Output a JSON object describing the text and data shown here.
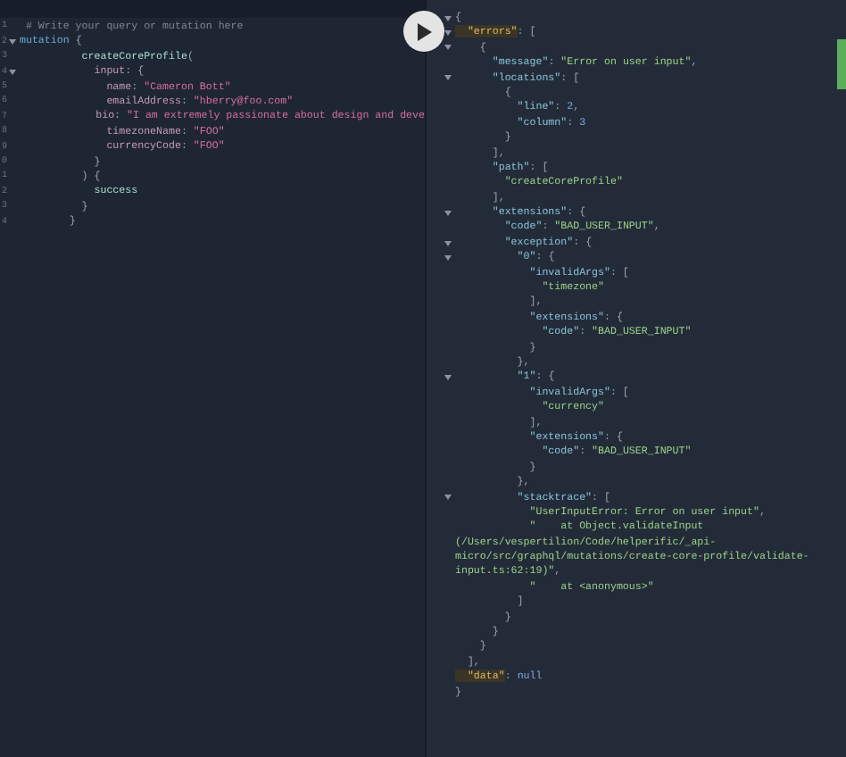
{
  "editor": {
    "lines": [
      {
        "number": "1",
        "fold": false,
        "tokens": [
          {
            "kind": "comment",
            "text": " # Write your query or mutation here"
          }
        ]
      },
      {
        "number": "2",
        "fold": true,
        "tokens": [
          {
            "kind": "keyword",
            "text": "mutation"
          },
          {
            "kind": "punct",
            "text": " {"
          }
        ]
      },
      {
        "number": "3",
        "fold": false,
        "tokens": [
          {
            "kind": "def",
            "text": "          createCoreProfile"
          },
          {
            "kind": "punct",
            "text": "("
          }
        ]
      },
      {
        "number": "4",
        "fold": true,
        "tokens": [
          {
            "kind": "attr",
            "text": "            input"
          },
          {
            "kind": "punct",
            "text": ": {"
          }
        ]
      },
      {
        "number": "5",
        "fold": false,
        "tokens": [
          {
            "kind": "attr",
            "text": "              name"
          },
          {
            "kind": "punct",
            "text": ": "
          },
          {
            "kind": "string",
            "text": "\"Cameron Bott\""
          }
        ]
      },
      {
        "number": "6",
        "fold": false,
        "tokens": [
          {
            "kind": "attr",
            "text": "              emailAddress"
          },
          {
            "kind": "punct",
            "text": ": "
          },
          {
            "kind": "string",
            "text": "\"hberry@foo.com\""
          }
        ]
      },
      {
        "number": "7",
        "fold": false,
        "tokens": [
          {
            "kind": "attr",
            "text": "              bio"
          },
          {
            "kind": "punct",
            "text": ": "
          },
          {
            "kind": "string",
            "text": "\"I am extremely passionate about design and deve"
          }
        ]
      },
      {
        "number": "8",
        "fold": false,
        "tokens": [
          {
            "kind": "attr",
            "text": "              timezoneName"
          },
          {
            "kind": "punct",
            "text": ": "
          },
          {
            "kind": "string",
            "text": "\"FOO\""
          }
        ]
      },
      {
        "number": "9",
        "fold": false,
        "tokens": [
          {
            "kind": "attr",
            "text": "              currencyCode"
          },
          {
            "kind": "punct",
            "text": ": "
          },
          {
            "kind": "string",
            "text": "\"FOO\""
          }
        ]
      },
      {
        "number": "0",
        "fold": false,
        "tokens": [
          {
            "kind": "punct",
            "text": "            }"
          }
        ]
      },
      {
        "number": "1",
        "fold": false,
        "tokens": [
          {
            "kind": "punct",
            "text": "          ) {"
          }
        ]
      },
      {
        "number": "2",
        "fold": false,
        "tokens": [
          {
            "kind": "field",
            "text": "            success"
          }
        ]
      },
      {
        "number": "3",
        "fold": false,
        "tokens": [
          {
            "kind": "punct",
            "text": "          }"
          }
        ]
      },
      {
        "number": "4",
        "fold": false,
        "tokens": [
          {
            "kind": "punct",
            "text": "        }"
          }
        ]
      }
    ]
  },
  "result": {
    "lines": [
      {
        "fold": true,
        "tokens": [
          {
            "kind": "punct",
            "text": "{"
          }
        ]
      },
      {
        "fold": true,
        "tokens": [
          {
            "kind": "topkey",
            "text": "  \"errors\""
          },
          {
            "kind": "punct",
            "text": ": ["
          }
        ]
      },
      {
        "fold": true,
        "tokens": [
          {
            "kind": "punct",
            "text": "    {"
          }
        ]
      },
      {
        "fold": false,
        "tokens": [
          {
            "kind": "key",
            "text": "      \"message\""
          },
          {
            "kind": "punct",
            "text": ": "
          },
          {
            "kind": "string",
            "text": "\"Error on user input\""
          },
          {
            "kind": "punct",
            "text": ","
          }
        ]
      },
      {
        "fold": true,
        "tokens": [
          {
            "kind": "key",
            "text": "      \"locations\""
          },
          {
            "kind": "punct",
            "text": ": ["
          }
        ]
      },
      {
        "fold": false,
        "tokens": [
          {
            "kind": "punct",
            "text": "        {"
          }
        ]
      },
      {
        "fold": false,
        "tokens": [
          {
            "kind": "key",
            "text": "          \"line\""
          },
          {
            "kind": "punct",
            "text": ": "
          },
          {
            "kind": "number",
            "text": "2"
          },
          {
            "kind": "punct",
            "text": ","
          }
        ]
      },
      {
        "fold": false,
        "tokens": [
          {
            "kind": "key",
            "text": "          \"column\""
          },
          {
            "kind": "punct",
            "text": ": "
          },
          {
            "kind": "number",
            "text": "3"
          }
        ]
      },
      {
        "fold": false,
        "tokens": [
          {
            "kind": "punct",
            "text": "        }"
          }
        ]
      },
      {
        "fold": false,
        "tokens": [
          {
            "kind": "punct",
            "text": "      ],"
          }
        ]
      },
      {
        "fold": false,
        "tokens": [
          {
            "kind": "key",
            "text": "      \"path\""
          },
          {
            "kind": "punct",
            "text": ": ["
          }
        ]
      },
      {
        "fold": false,
        "tokens": [
          {
            "kind": "string",
            "text": "        \"createCoreProfile\""
          }
        ]
      },
      {
        "fold": false,
        "tokens": [
          {
            "kind": "punct",
            "text": "      ],"
          }
        ]
      },
      {
        "fold": true,
        "tokens": [
          {
            "kind": "key",
            "text": "      \"extensions\""
          },
          {
            "kind": "punct",
            "text": ": {"
          }
        ]
      },
      {
        "fold": false,
        "tokens": [
          {
            "kind": "key",
            "text": "        \"code\""
          },
          {
            "kind": "punct",
            "text": ": "
          },
          {
            "kind": "string",
            "text": "\"BAD_USER_INPUT\""
          },
          {
            "kind": "punct",
            "text": ","
          }
        ]
      },
      {
        "fold": true,
        "tokens": [
          {
            "kind": "key",
            "text": "        \"exception\""
          },
          {
            "kind": "punct",
            "text": ": {"
          }
        ]
      },
      {
        "fold": true,
        "tokens": [
          {
            "kind": "key",
            "text": "          \"0\""
          },
          {
            "kind": "punct",
            "text": ": {"
          }
        ]
      },
      {
        "fold": false,
        "tokens": [
          {
            "kind": "key",
            "text": "            \"invalidArgs\""
          },
          {
            "kind": "punct",
            "text": ": ["
          }
        ]
      },
      {
        "fold": false,
        "tokens": [
          {
            "kind": "string",
            "text": "              \"timezone\""
          }
        ]
      },
      {
        "fold": false,
        "tokens": [
          {
            "kind": "punct",
            "text": "            ],"
          }
        ]
      },
      {
        "fold": false,
        "tokens": [
          {
            "kind": "key",
            "text": "            \"extensions\""
          },
          {
            "kind": "punct",
            "text": ": {"
          }
        ]
      },
      {
        "fold": false,
        "tokens": [
          {
            "kind": "key",
            "text": "              \"code\""
          },
          {
            "kind": "punct",
            "text": ": "
          },
          {
            "kind": "string",
            "text": "\"BAD_USER_INPUT\""
          }
        ]
      },
      {
        "fold": false,
        "tokens": [
          {
            "kind": "punct",
            "text": "            }"
          }
        ]
      },
      {
        "fold": false,
        "tokens": [
          {
            "kind": "punct",
            "text": "          },"
          }
        ]
      },
      {
        "fold": true,
        "tokens": [
          {
            "kind": "key",
            "text": "          \"1\""
          },
          {
            "kind": "punct",
            "text": ": {"
          }
        ]
      },
      {
        "fold": false,
        "tokens": [
          {
            "kind": "key",
            "text": "            \"invalidArgs\""
          },
          {
            "kind": "punct",
            "text": ": ["
          }
        ]
      },
      {
        "fold": false,
        "tokens": [
          {
            "kind": "string",
            "text": "              \"currency\""
          }
        ]
      },
      {
        "fold": false,
        "tokens": [
          {
            "kind": "punct",
            "text": "            ],"
          }
        ]
      },
      {
        "fold": false,
        "tokens": [
          {
            "kind": "key",
            "text": "            \"extensions\""
          },
          {
            "kind": "punct",
            "text": ": {"
          }
        ]
      },
      {
        "fold": false,
        "tokens": [
          {
            "kind": "key",
            "text": "              \"code\""
          },
          {
            "kind": "punct",
            "text": ": "
          },
          {
            "kind": "string",
            "text": "\"BAD_USER_INPUT\""
          }
        ]
      },
      {
        "fold": false,
        "tokens": [
          {
            "kind": "punct",
            "text": "            }"
          }
        ]
      },
      {
        "fold": false,
        "tokens": [
          {
            "kind": "punct",
            "text": "          },"
          }
        ]
      },
      {
        "fold": true,
        "tokens": [
          {
            "kind": "key",
            "text": "          \"stacktrace\""
          },
          {
            "kind": "punct",
            "text": ": ["
          }
        ]
      },
      {
        "fold": false,
        "tokens": [
          {
            "kind": "string",
            "text": "            \"UserInputError: Error on user input\""
          },
          {
            "kind": "punct",
            "text": ","
          }
        ]
      },
      {
        "fold": false,
        "tokens": [
          {
            "kind": "string",
            "text": "            \"    at Object.validateInput"
          }
        ]
      },
      {
        "fold": false,
        "tokens": [
          {
            "kind": "string",
            "text": "(/Users/vespertilion/Code/helperific/_api-"
          }
        ]
      },
      {
        "fold": false,
        "tokens": [
          {
            "kind": "string",
            "text": "micro/src/graphql/mutations/create-core-profile/validate-"
          }
        ]
      },
      {
        "fold": false,
        "tokens": [
          {
            "kind": "string",
            "text": "input.ts:62:19)\""
          },
          {
            "kind": "punct",
            "text": ","
          }
        ]
      },
      {
        "fold": false,
        "tokens": [
          {
            "kind": "string",
            "text": "            \"    at <anonymous>\""
          }
        ]
      },
      {
        "fold": false,
        "tokens": [
          {
            "kind": "punct",
            "text": "          ]"
          }
        ]
      },
      {
        "fold": false,
        "tokens": [
          {
            "kind": "punct",
            "text": "        }"
          }
        ]
      },
      {
        "fold": false,
        "tokens": [
          {
            "kind": "punct",
            "text": "      }"
          }
        ]
      },
      {
        "fold": false,
        "tokens": [
          {
            "kind": "punct",
            "text": "    }"
          }
        ]
      },
      {
        "fold": false,
        "tokens": [
          {
            "kind": "punct",
            "text": "  ],"
          }
        ]
      },
      {
        "fold": false,
        "tokens": [
          {
            "kind": "topkey",
            "text": "  \"data\""
          },
          {
            "kind": "punct",
            "text": ": "
          },
          {
            "kind": "null",
            "text": "null"
          }
        ]
      },
      {
        "fold": false,
        "tokens": [
          {
            "kind": "punct",
            "text": "}"
          }
        ]
      }
    ]
  }
}
